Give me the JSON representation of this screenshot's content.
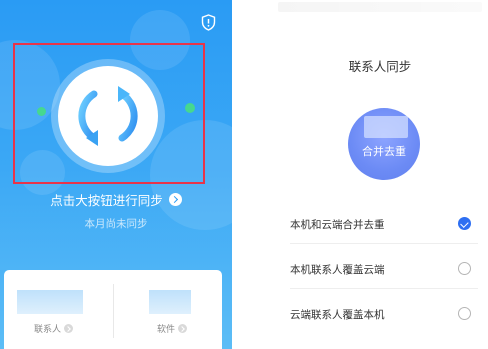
{
  "left_panel": {
    "sync_action_text": "点击大按钮进行同步",
    "month_status_text": "本月尚未同步",
    "icons": {
      "shield": "shield-alert-icon",
      "sync": "sync-arrows-icon",
      "go": "chevron-right-icon"
    },
    "cards": [
      {
        "label": "联系人"
      },
      {
        "label": "软件"
      }
    ],
    "colors": {
      "gradient_top": "#2a9bf4",
      "gradient_bottom": "#5cbdf6",
      "accent_dot": "#46d88f",
      "highlight_box": "#e8344a"
    }
  },
  "right_panel": {
    "title": "联系人同步",
    "merge_button_label": "合并去重",
    "options": [
      {
        "label": "本机和云端合并去重",
        "selected": true
      },
      {
        "label": "本机联系人覆盖云端",
        "selected": false
      },
      {
        "label": "云端联系人覆盖本机",
        "selected": false
      }
    ],
    "colors": {
      "merge_circle": "#6c8bf5",
      "selected_radio": "#2e6ff2"
    }
  }
}
